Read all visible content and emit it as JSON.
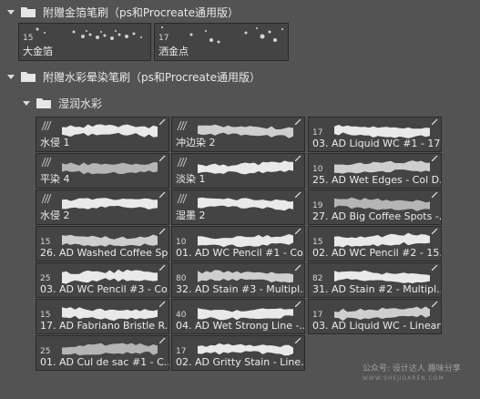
{
  "folders": [
    {
      "title": "附赠金箔笔刷（ps和Procreate通用版）"
    },
    {
      "title": "附赠水彩晕染笔刷（ps和Procreate通用版）"
    },
    {
      "title": "湿润水彩"
    }
  ],
  "top_brushes": [
    {
      "num": "15",
      "label": "大金箔"
    },
    {
      "num": "17",
      "label": "洒金点"
    }
  ],
  "brushes": [
    {
      "num": "",
      "label": "水侵 1"
    },
    {
      "num": "",
      "label": "冲边染 2"
    },
    {
      "num": "17",
      "label": "03. AD Liquid WC #1 - 17..."
    },
    {
      "num": "",
      "label": "平染 4"
    },
    {
      "num": "",
      "label": "淡染 1"
    },
    {
      "num": "10",
      "label": "25. AD Wet Edges - Col D..."
    },
    {
      "num": "",
      "label": "水侵 2"
    },
    {
      "num": "",
      "label": "湿墨 2"
    },
    {
      "num": "19",
      "label": "27. AD Big Coffee Spots -..."
    },
    {
      "num": "15",
      "label": "26. AD Washed Coffee Sp..."
    },
    {
      "num": "10",
      "label": "01. AD WC Pencil #1 - Co..."
    },
    {
      "num": "15",
      "label": "02. AD WC Pencil #2 - 15..."
    },
    {
      "num": "25",
      "label": "03. AD WC Pencil #3 - Co..."
    },
    {
      "num": "80",
      "label": "32. AD Stain #3 - Multipl..."
    },
    {
      "num": "82",
      "label": "31. AD Stain #2 - Multipl..."
    },
    {
      "num": "15",
      "label": "17. AD Fabriano Bristle R..."
    },
    {
      "num": "40",
      "label": "04. AD Wet Strong Line -..."
    },
    {
      "num": "17",
      "label": "03. AD Liquid WC - Linear..."
    },
    {
      "num": "25",
      "label": "01. AD Cul de sac #1 - C..."
    },
    {
      "num": "17",
      "label": "02. AD Gritty Stain - Line..."
    }
  ],
  "watermark": {
    "line1": "公众号: 设计达人  趣味分享",
    "line2": "WWW.SHEJIDAREN.COM"
  }
}
